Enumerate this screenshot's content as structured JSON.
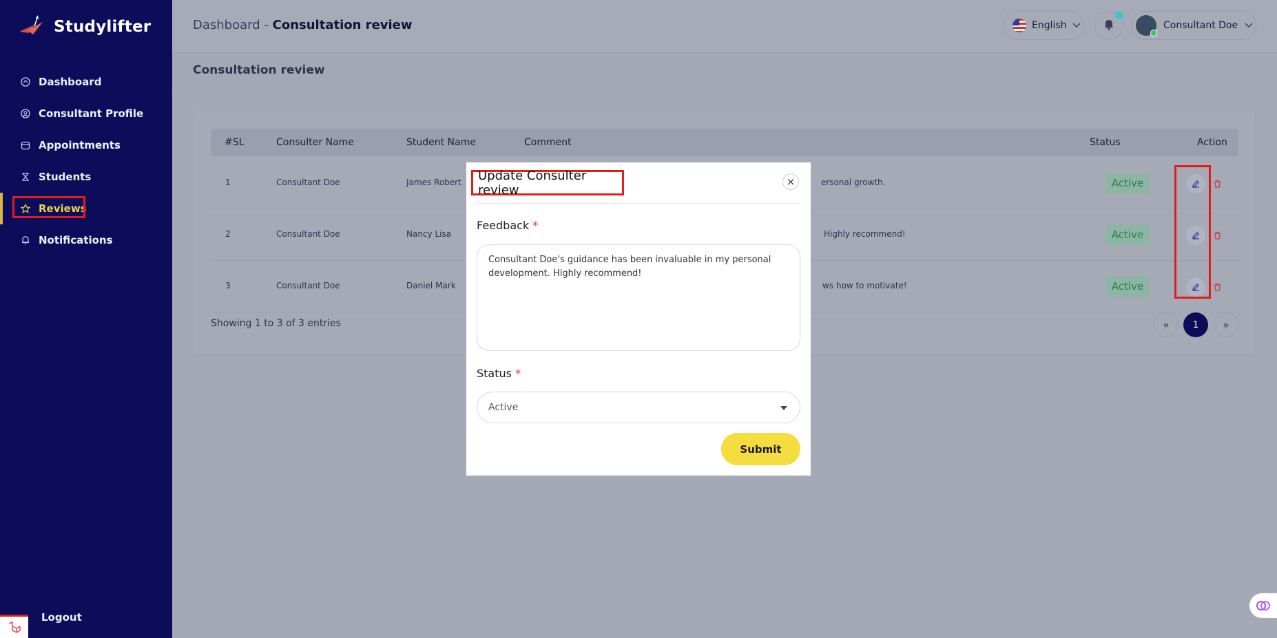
{
  "brand": {
    "name": "Studylifter"
  },
  "sidebar": {
    "items": [
      {
        "label": "Dashboard",
        "icon": "home-icon"
      },
      {
        "label": "Consultant Profile",
        "icon": "user-circle-icon"
      },
      {
        "label": "Appointments",
        "icon": "calendar-icon"
      },
      {
        "label": "Students",
        "icon": "student-icon"
      },
      {
        "label": "Reviews",
        "icon": "star-icon",
        "active": true
      },
      {
        "label": "Notifications",
        "icon": "bell-icon"
      }
    ],
    "logout": "Logout"
  },
  "header": {
    "breadcrumb_root": "Dashboard",
    "breadcrumb_sep": "-",
    "breadcrumb_current": "Consultation review",
    "language": "English",
    "user_name": "Consultant Doe"
  },
  "page": {
    "title": "Consultation review"
  },
  "table": {
    "headers": [
      "#SL",
      "Consulter Name",
      "Student Name",
      "Comment",
      "Status",
      "Action"
    ],
    "rows": [
      {
        "sl": "1",
        "consulter": "Consultant Doe",
        "student": "James Robert",
        "comment": "ersonal growth.",
        "status": "Active"
      },
      {
        "sl": "2",
        "consulter": "Consultant Doe",
        "student": "Nancy Lisa",
        "comment": "Highly recommend!",
        "status": "Active"
      },
      {
        "sl": "3",
        "consulter": "Consultant Doe",
        "student": "Daniel Mark",
        "comment": "ws how to motivate!",
        "status": "Active"
      }
    ],
    "showing": "Showing 1 to 3 of 3 entries",
    "pagination": {
      "prev": "«",
      "current": "1",
      "next": "»"
    }
  },
  "modal": {
    "title": "Update Consulter review",
    "close": "×",
    "feedback_label": "Feedback",
    "required_mark": "*",
    "feedback_value": "Consultant Doe's guidance has been invaluable in my personal development. Highly recommend!",
    "status_label": "Status",
    "status_value": "Active",
    "submit": "Submit"
  },
  "colors": {
    "sidebar_bg": "#0c0c5a",
    "active_accent": "#f0d34a",
    "submit_bg": "#f5dd3f",
    "highlight_box": "#e31b1b",
    "badge_text": "#2a7f4f"
  }
}
